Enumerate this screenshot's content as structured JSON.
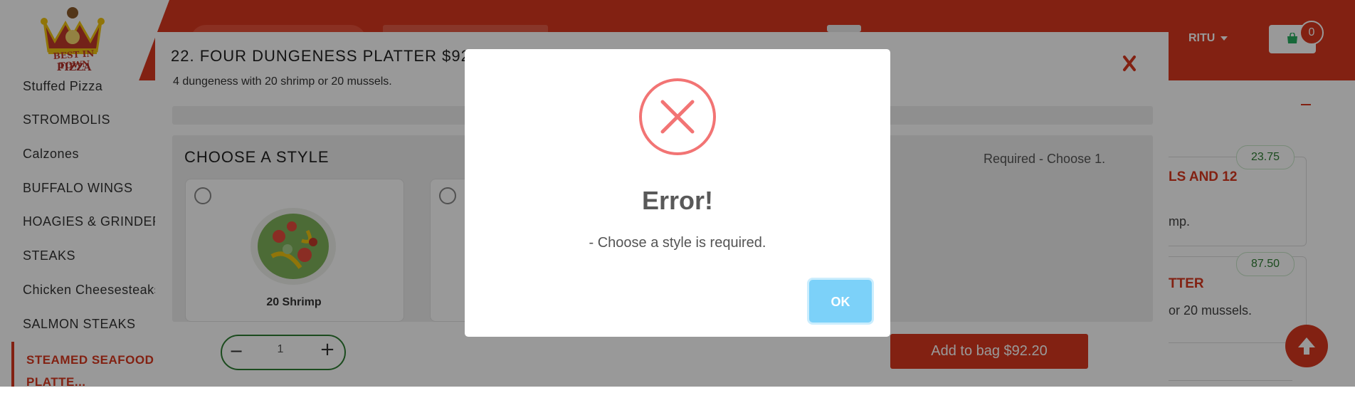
{
  "header": {
    "logo_line1": "BEST IN TOWN",
    "logo_line2": "PIZZA",
    "user_name": "RITU",
    "cart_count": "0"
  },
  "sidebar": {
    "items": [
      {
        "label": "Stuffed Pizza"
      },
      {
        "label": "STROMBOLIS"
      },
      {
        "label": "Calzones"
      },
      {
        "label": "BUFFALO WINGS"
      },
      {
        "label": "HOAGIES & GRINDERS"
      },
      {
        "label": "STEAKS"
      },
      {
        "label": "Chicken Cheesesteaks"
      },
      {
        "label": "SALMON STEAKS"
      }
    ],
    "active_item": "STEAMED SEAFOOD PLATTE..."
  },
  "background_menu": {
    "cards": [
      {
        "price": "23.75",
        "title_fragment": "LS AND 12",
        "desc_fragment": "mp."
      },
      {
        "price": "87.50",
        "title_fragment": "TTER",
        "desc_fragment": "or 20 mussels."
      }
    ]
  },
  "item_modal": {
    "title": "22. FOUR DUNGENESS PLATTER  $92",
    "description": "4 dungeness with 20 shrimp or 20 mussels.",
    "section_title": "CHOOSE A STYLE",
    "section_requirement": "Required - Choose 1.",
    "options": [
      {
        "label": "20 Shrimp"
      }
    ],
    "quantity": "1",
    "add_button_label": "Add to bag $92.20"
  },
  "alert": {
    "title": "Error!",
    "message": "- Choose a style is required.",
    "ok_label": "OK",
    "icon": "error-x-icon"
  },
  "colors": {
    "brand_red": "#d9381e",
    "alert_icon": "#f27474",
    "ok_button": "#7cd1f9",
    "price_green": "#2e7d32"
  }
}
